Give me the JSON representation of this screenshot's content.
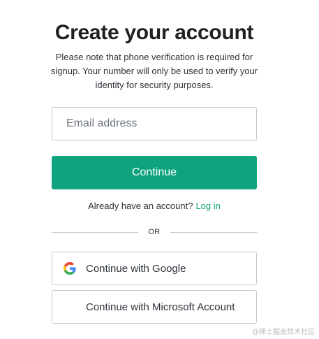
{
  "header": {
    "title": "Create your account",
    "subtitle": "Please note that phone verification is required for signup. Your number will only be used to verify your identity for security purposes."
  },
  "form": {
    "email_placeholder": "Email address",
    "email_value": "",
    "continue_label": "Continue"
  },
  "login": {
    "prompt": "Already have an account?",
    "link_label": "Log in"
  },
  "divider": {
    "label": "OR"
  },
  "social": {
    "google_label": "Continue with Google",
    "google_icon": "google-icon",
    "microsoft_label": "Continue with Microsoft Account",
    "microsoft_icon": "microsoft-icon"
  },
  "watermark": {
    "text": "@稀土掘金技术社区"
  },
  "colors": {
    "accent": "#10a37f",
    "text": "#2d333a",
    "border": "#c2c8d0",
    "ms_red": "#f25022",
    "ms_green": "#7fba00",
    "ms_blue": "#00a4ef",
    "ms_yellow": "#ffb900"
  }
}
